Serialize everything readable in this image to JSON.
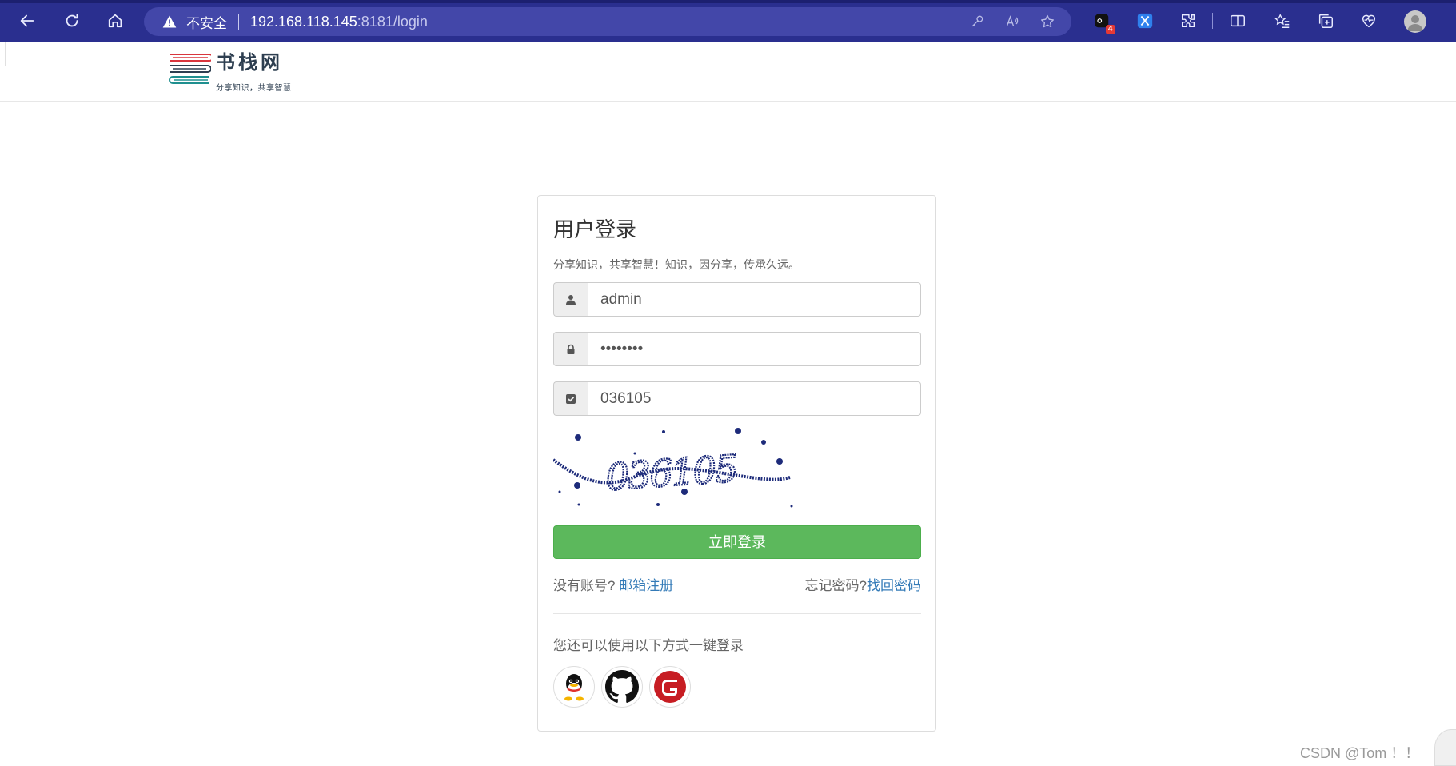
{
  "browser": {
    "insecure_label": "不安全",
    "url_host": "192.168.118.145",
    "url_rest": ":8181/login",
    "badge_count": "4"
  },
  "site": {
    "name": "书栈网",
    "slogan": "分享知识，共享智慧"
  },
  "login": {
    "title": "用户登录",
    "subtitle": "分享知识，共享智慧！知识，因分享，传承久远。",
    "username": "admin",
    "password": "12345678",
    "captcha_value": "036105",
    "captcha_image_text": "036105",
    "submit_label": "立即登录",
    "no_account_text": "没有账号?",
    "register_link": "邮箱注册",
    "forgot_text": "忘记密码?",
    "recover_link": "找回密码",
    "oauth_text": "您还可以使用以下方式一键登录",
    "oauth_providers": [
      "qq-icon",
      "github-icon",
      "gitee-icon"
    ]
  },
  "colors": {
    "chrome": "#2a2f8f",
    "primary_button": "#5cb85c",
    "link": "#337ab7",
    "gitee": "#c71d23"
  },
  "watermark": "CSDN @Tom ！！"
}
